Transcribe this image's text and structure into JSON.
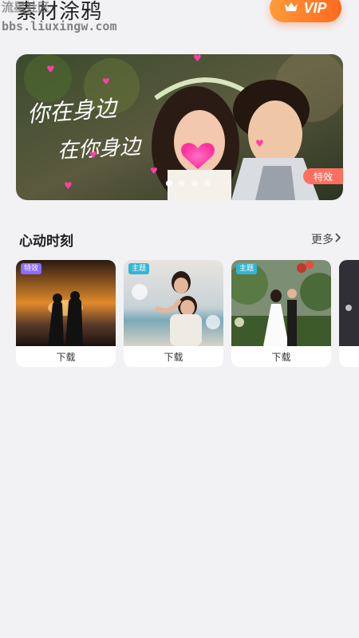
{
  "header": {
    "title": "素材涂鸦",
    "vip_label": "VIP",
    "watermark_line1": "流星社区",
    "watermark_line2": "bbs.liuxingw.com"
  },
  "banner": {
    "overlay_text_line1": "你在身边",
    "overlay_text_line2": "在你身边",
    "tag": "特效",
    "slides": 4,
    "active_slide": 1
  },
  "section": {
    "title": "心动时刻",
    "more_label": "更多"
  },
  "cards": [
    {
      "badge": "特效",
      "badge_color": "#8a6cff",
      "download_label": "下载"
    },
    {
      "badge": "主题",
      "badge_color": "#33b5d6",
      "download_label": "下载"
    },
    {
      "badge": "主题",
      "badge_color": "#33b5d6",
      "download_label": "下载"
    }
  ],
  "colors": {
    "accent": "#ff7a2a",
    "background": "#f2f2f5",
    "heart_pink": "#ff3fa4"
  }
}
